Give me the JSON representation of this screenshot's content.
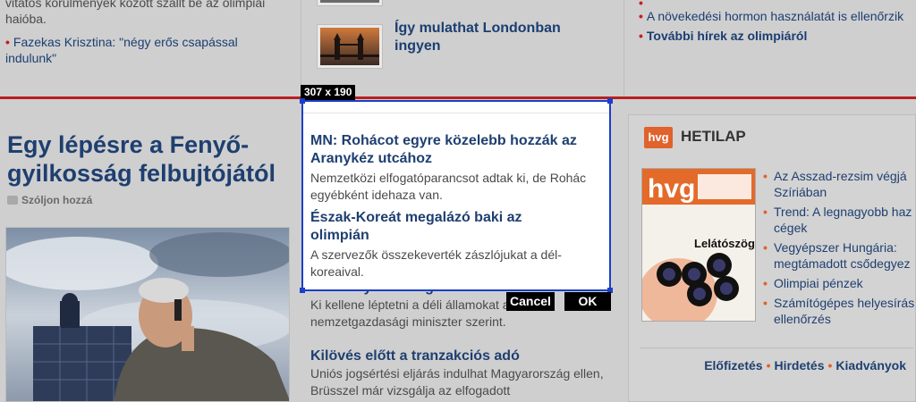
{
  "top_left": {
    "text_partial": "vitatós körülmények között szállt be az olimpiai hajóba.",
    "item": "Fazekas Krisztina: \"négy erős csapással indulunk\""
  },
  "top_center": {
    "title": "Így mulathat Londonban ingyen"
  },
  "top_right": {
    "items": [
      "A növekedési hormon használatát is ellenőrzik",
      "További hírek az olimpiáról"
    ]
  },
  "main": {
    "title": "Egy lépésre a Fenyő-gyilkosság felbujtójától",
    "comment": "Szóljon hozzá"
  },
  "selection": {
    "size_label": "307 x 190",
    "cancel": "Cancel",
    "ok": "OK"
  },
  "center": {
    "articles": [
      {
        "title": "MN: Rohácot egyre közelebb hozzák az Aranykéz utcához",
        "desc": "Nemzetközi elfogatóparancsot adtak ki, de Rohác egyébként idehaza van."
      },
      {
        "title": "Észak-Koreát megalázó baki az olimpián",
        "desc": "A szervezők összekeverték zászlójukat a dél-koreaival."
      },
      {
        "title": "Matolcsy kettévágná az eur",
        "desc": "Ki kellene léptetni a déli államokat a nemzetgazdasági miniszter szerint."
      },
      {
        "title": "Kilövés előtt a tranzakciós adó",
        "desc": "Uniós jogsértési eljárás indulhat Magyarország ellen, Brüsszel már vizsgálja az elfogadott"
      }
    ]
  },
  "sidebar": {
    "logo": "hvg",
    "heading": "HETILAP",
    "magazine_logo": "hvg",
    "magazine_cover_title": "Lelátószög",
    "items": [
      "Az Asszad-rezsim végjá Szíriában",
      "Trend: A legnagyobb haz cégek",
      "Vegyépszer Hungária: megtámadott csődegyez",
      "Olimpiai pénzek",
      "Számítógépes helyesírás ellenőrzés"
    ],
    "footer": [
      "Előfizetés",
      "Hirdetés",
      "Kiadványok"
    ]
  },
  "colors": {
    "link": "#1e3f70",
    "accent_red": "#b92020",
    "hvg_orange": "#e0622c",
    "selection_blue": "#1a3ec8"
  }
}
